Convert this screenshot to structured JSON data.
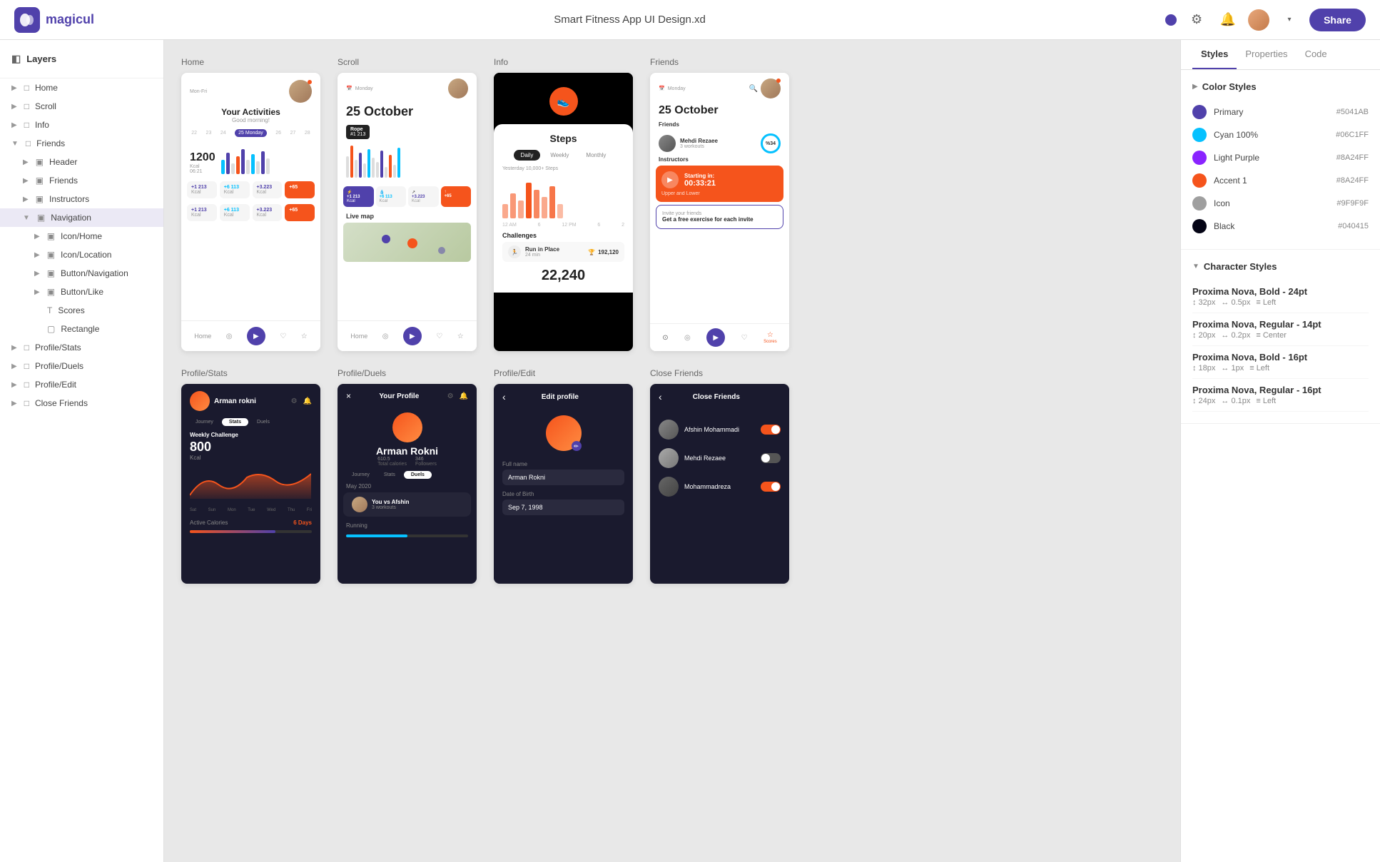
{
  "app": {
    "name": "magicul",
    "title": "Smart Fitness App UI Design.xd"
  },
  "topnav": {
    "share_label": "Share",
    "title": "Smart Fitness App UI Design.xd"
  },
  "left_panel": {
    "layers_header": "Layers",
    "items": [
      {
        "id": "home",
        "label": "Home",
        "type": "page",
        "indent": 0,
        "expanded": false
      },
      {
        "id": "scroll",
        "label": "Scroll",
        "type": "page",
        "indent": 0,
        "expanded": false
      },
      {
        "id": "info",
        "label": "Info",
        "type": "page",
        "indent": 0,
        "expanded": false
      },
      {
        "id": "friends",
        "label": "Friends",
        "type": "page",
        "indent": 0,
        "expanded": true
      },
      {
        "id": "header",
        "label": "Header",
        "type": "folder",
        "indent": 1,
        "expanded": false
      },
      {
        "id": "friends-sub",
        "label": "Friends",
        "type": "folder",
        "indent": 1,
        "expanded": false
      },
      {
        "id": "instructors",
        "label": "Instructors",
        "type": "folder",
        "indent": 1,
        "expanded": false
      },
      {
        "id": "navigation",
        "label": "Navigation",
        "type": "folder",
        "indent": 1,
        "expanded": true,
        "active": true
      },
      {
        "id": "icon-home",
        "label": "Icon/Home",
        "type": "folder",
        "indent": 2,
        "expanded": false
      },
      {
        "id": "icon-location",
        "label": "Icon/Location",
        "type": "folder",
        "indent": 2,
        "expanded": false
      },
      {
        "id": "button-nav",
        "label": "Button/Navigation",
        "type": "folder",
        "indent": 2,
        "expanded": false
      },
      {
        "id": "button-like",
        "label": "Button/Like",
        "type": "folder",
        "indent": 2,
        "expanded": false
      },
      {
        "id": "scores",
        "label": "Scores",
        "type": "text",
        "indent": 2,
        "expanded": false
      },
      {
        "id": "rectangle",
        "label": "Rectangle",
        "type": "rect",
        "indent": 2,
        "expanded": false
      },
      {
        "id": "profile-stats",
        "label": "Profile/Stats",
        "type": "page",
        "indent": 0,
        "expanded": false
      },
      {
        "id": "profile-duels",
        "label": "Profile/Duels",
        "type": "page",
        "indent": 0,
        "expanded": false
      },
      {
        "id": "profile-edit",
        "label": "Profile/Edit",
        "type": "page",
        "indent": 0,
        "expanded": false
      },
      {
        "id": "close-friends",
        "label": "Close Friends",
        "type": "page",
        "indent": 0,
        "expanded": false
      }
    ],
    "section_labels": {
      "navigation": "Navigation",
      "info": "Info",
      "profile_stats": "Profile Stats",
      "layers": "Layers"
    }
  },
  "canvas": {
    "row1_labels": [
      "Home",
      "Scroll",
      "Info",
      "Friends"
    ],
    "row2_labels": [
      "Profile/Stats",
      "Profile/Duels",
      "Profile/Edit",
      "Close Friends"
    ],
    "home": {
      "date_label": "25 Monday",
      "date_range": "22   23   24   25 Monday   26   27   28",
      "title": "Your Activities",
      "subtitle": "Good morning!",
      "kcal": "1200",
      "kcal_label": "Kcal",
      "time": "06:21",
      "card1": "+1 213 Kcal",
      "card2": "+6 113 Kcal",
      "card3": "+3.223 Kcal",
      "card4": "+65",
      "nav_items": [
        "Home",
        "",
        "",
        ""
      ]
    },
    "scroll": {
      "day": "Monday",
      "date": "25 October",
      "chart_label": "Rope",
      "chart_value": "#1 213",
      "live_map": "Live map",
      "card1": "+1 213 Kcal",
      "card2": "+6 113 Kcal",
      "card3": "+3.223 Kcal",
      "card4": "+65",
      "nav_items": [
        "Home",
        "",
        "",
        ""
      ]
    },
    "info": {
      "title": "Steps",
      "tabs": [
        "Daily",
        "Weekly",
        "Monthly"
      ],
      "yesterday": "Yesterday  10,000+ Steps",
      "total": "22,240",
      "challenges": "Challenges",
      "challenge_name": "Run in Place",
      "challenge_time": "24 min",
      "challenge_score": "192,120"
    },
    "friends": {
      "day": "Monday",
      "date": "25 October",
      "section1": "Friends",
      "person1": "Mehdi Rezaee",
      "person1_sub": "3 workouts",
      "percent": "%34",
      "section2": "Instructors",
      "card_title": "Starting in:",
      "card_time": "00:33:21",
      "card_sub": "Upper and Lower",
      "invite_title": "Invite your friends",
      "invite_sub": "Get a free exercise for each invite",
      "nav_items": [
        "Home",
        "",
        "",
        "Scores"
      ]
    },
    "profile_stats": {
      "name": "Arman rokni",
      "tabs": [
        "Journey",
        "Stats",
        "Duels"
      ],
      "active_tab": "Stats",
      "weekly": "Weekly Challenge",
      "kcal": "800",
      "kcal_label": "Kcal",
      "active_cal": "Active Calories",
      "days": "6 Days"
    },
    "profile_duels": {
      "close_btn": "×",
      "title": "Your Profile",
      "name": "Arman Rokni",
      "calories": "610.5",
      "cal_label": "Total calories",
      "followers": "346",
      "fol_label": "Followers",
      "tabs": [
        "Journey",
        "Stats",
        "Duels"
      ],
      "active_tab": "Duels",
      "date": "May 2020",
      "opponent": "You vs Afshin",
      "opponent_sub": "3 workouts",
      "activity": "Running"
    },
    "profile_edit": {
      "back": "‹",
      "title": "Edit profile",
      "full_name_label": "Full name",
      "full_name": "Arman Rokni",
      "dob_label": "Date of Birth",
      "dob": "Sep 7, 1998"
    },
    "close_friends": {
      "back": "‹",
      "title": "Close Friends",
      "person1": "Afshin Mohammadi",
      "person2": "Mehdi Rezaee",
      "person3": "Mohammadreza",
      "toggle1": "on",
      "toggle2": "off",
      "toggle3": "on"
    }
  },
  "right_panel": {
    "tabs": [
      "Styles",
      "Properties",
      "Code"
    ],
    "active_tab": "Styles",
    "color_styles": {
      "title": "Color Styles",
      "colors": [
        {
          "name": "Primary",
          "hex": "#5041AB",
          "value": "#5041AB"
        },
        {
          "name": "Cyan 100%",
          "hex": "#06C1FF",
          "value": "#06C1FF"
        },
        {
          "name": "Light Purple",
          "hex": "#8A24FF",
          "value": "#8A24FF"
        },
        {
          "name": "Accent 1",
          "hex": "#8A24FF",
          "value": "#f5541c"
        },
        {
          "name": "Icon",
          "hex": "#9F9F9F",
          "value": "#9F9F9F"
        },
        {
          "name": "Black",
          "hex": "#040415",
          "value": "#040415"
        }
      ]
    },
    "char_styles": {
      "title": "Character Styles",
      "styles": [
        {
          "name": "Proxima Nova, Bold - 24pt",
          "size": "↕ 32px",
          "spacing": "↔ 0.5px",
          "align": "≡ Left"
        },
        {
          "name": "Proxima Nova, Regular - 14pt",
          "size": "↕ 20px",
          "spacing": "↔ 0.2px",
          "align": "≡ Center"
        },
        {
          "name": "Proxima Nova, Bold - 16pt",
          "size": "↕ 18px",
          "spacing": "↔ 1px",
          "align": "≡ Left"
        },
        {
          "name": "Proxima Nova, Regular - 16pt",
          "size": "↕ 24px",
          "spacing": "↔ 0.1px",
          "align": "≡ Left"
        }
      ]
    }
  }
}
